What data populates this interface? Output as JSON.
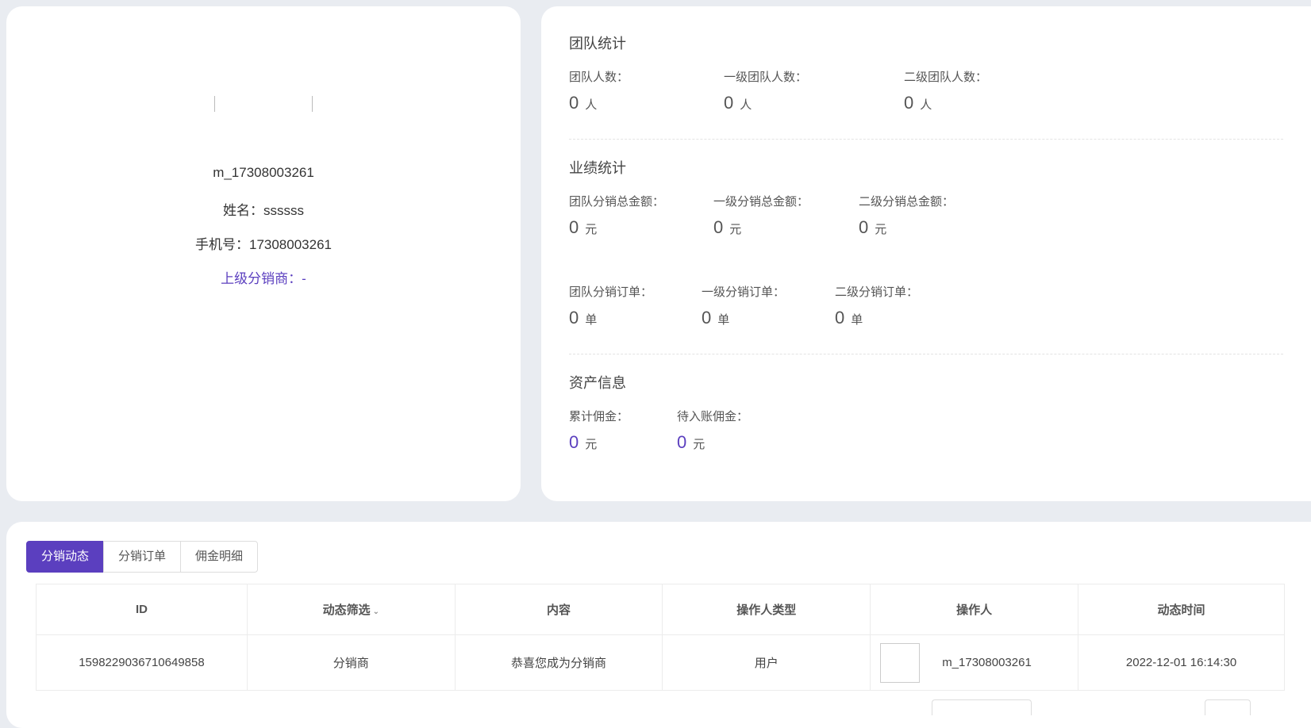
{
  "profile": {
    "username": "m_17308003261",
    "name": "姓名：ssssss",
    "phone": "手机号：17308003261",
    "superior": "上级分销商：-"
  },
  "team": {
    "title": "团队统计",
    "items": [
      {
        "label": "团队人数：",
        "value": "0",
        "unit": "人"
      },
      {
        "label": "一级团队人数：",
        "value": "0",
        "unit": "人"
      },
      {
        "label": "二级团队人数：",
        "value": "0",
        "unit": "人"
      }
    ]
  },
  "performance": {
    "title": "业绩统计",
    "amounts": [
      {
        "label": "团队分销总金额：",
        "value": "0",
        "unit": "元"
      },
      {
        "label": "一级分销总金额：",
        "value": "0",
        "unit": "元"
      },
      {
        "label": "二级分销总金额：",
        "value": "0",
        "unit": "元"
      }
    ],
    "orders": [
      {
        "label": "团队分销订单：",
        "value": "0",
        "unit": "单"
      },
      {
        "label": "一级分销订单：",
        "value": "0",
        "unit": "单"
      },
      {
        "label": "二级分销订单：",
        "value": "0",
        "unit": "单"
      }
    ]
  },
  "assets": {
    "title": "资产信息",
    "items": [
      {
        "label": "累计佣金：",
        "value": "0",
        "unit": "元"
      },
      {
        "label": "待入账佣金：",
        "value": "0",
        "unit": "元"
      }
    ]
  },
  "tabs": [
    "分销动态",
    "分销订单",
    "佣金明细"
  ],
  "table": {
    "headers": [
      "ID",
      "动态筛选",
      "内容",
      "操作人类型",
      "操作人",
      "动态时间"
    ],
    "rows": [
      [
        "1598229036710649858",
        "分销商",
        "恭喜您成为分销商",
        "用户",
        "m_17308003261",
        "2022-12-01 16:14:30"
      ]
    ]
  },
  "colors": {
    "accent": "#5b3fbf"
  }
}
